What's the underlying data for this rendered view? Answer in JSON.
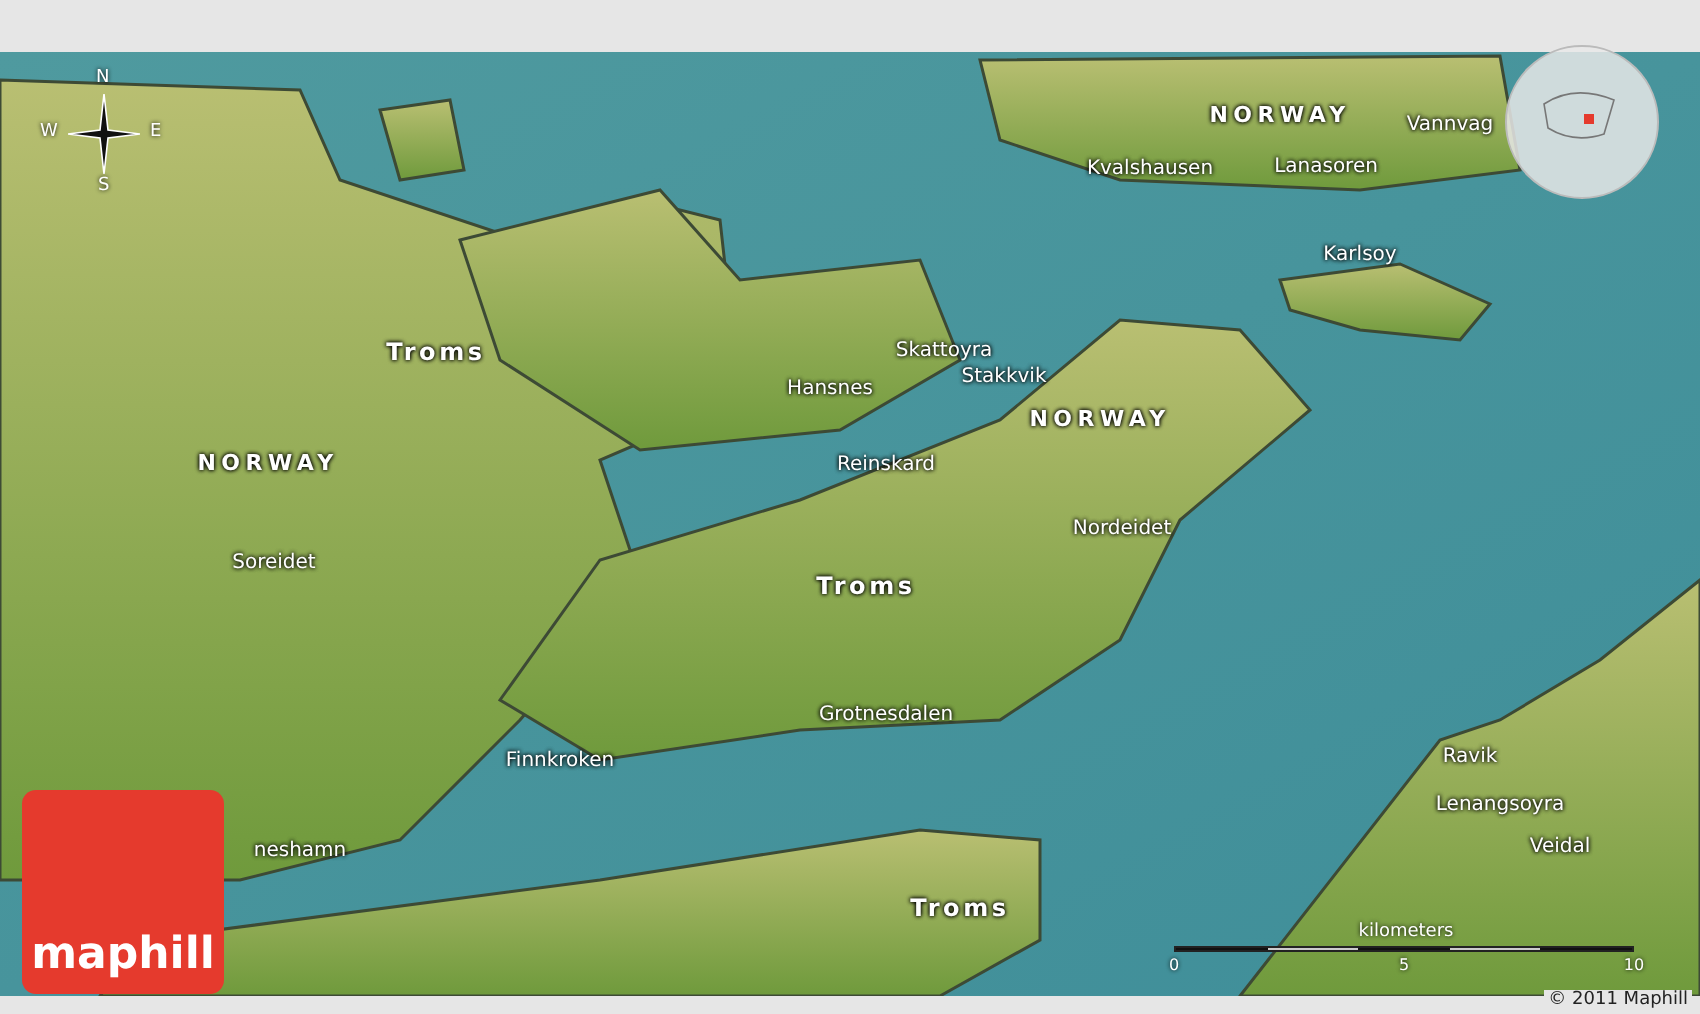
{
  "compass": {
    "north": "N",
    "south": "S",
    "west": "W",
    "east": "E"
  },
  "labels": [
    {
      "text": "NORWAY",
      "kind": "country"
    },
    {
      "text": "Kvalshausen",
      "kind": "place"
    },
    {
      "text": "Lanasoren",
      "kind": "place"
    },
    {
      "text": "Vannvag",
      "kind": "place"
    },
    {
      "text": "Karlsoy",
      "kind": "place"
    },
    {
      "text": "Troms",
      "kind": "region"
    },
    {
      "text": "Skattoyra",
      "kind": "place"
    },
    {
      "text": "Hansnes",
      "kind": "place"
    },
    {
      "text": "Stakkvik",
      "kind": "place"
    },
    {
      "text": "NORWAY",
      "kind": "country"
    },
    {
      "text": "NORWAY",
      "kind": "country"
    },
    {
      "text": "Reinskard",
      "kind": "place"
    },
    {
      "text": "Nordeidet",
      "kind": "place"
    },
    {
      "text": "Soreidet",
      "kind": "place"
    },
    {
      "text": "Troms",
      "kind": "region"
    },
    {
      "text": "Grotnesdalen",
      "kind": "place"
    },
    {
      "text": "Finnkroken",
      "kind": "place"
    },
    {
      "text": "Ravik",
      "kind": "place"
    },
    {
      "text": "Lenangsoyra",
      "kind": "place"
    },
    {
      "text": "neshamn",
      "kind": "place"
    },
    {
      "text": "Veidal",
      "kind": "place"
    },
    {
      "text": "Troms",
      "kind": "region"
    }
  ],
  "scale": {
    "title": "kilometers",
    "ticks": [
      "0",
      "5",
      "10"
    ]
  },
  "copyright": "© 2011 Maphill",
  "logo": "maphill"
}
